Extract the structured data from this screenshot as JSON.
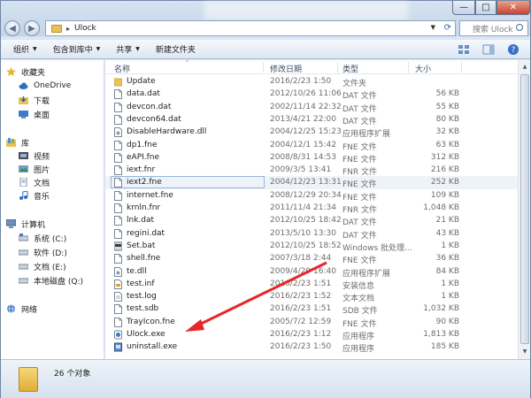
{
  "window": {
    "title": "Ulock",
    "controls": {
      "minimize": "—",
      "maximize": "□",
      "close": "✕"
    }
  },
  "nav": {
    "back": "◀",
    "forward": "▶"
  },
  "address": {
    "path": "Ulock",
    "separator": "▸"
  },
  "search": {
    "placeholder": "搜索 Ulock"
  },
  "toolbar": {
    "organize": "组织",
    "include": "包含到库中",
    "share": "共享",
    "new_folder": "新建文件夹"
  },
  "sidebar": {
    "favorites": "收藏夹",
    "onedrive": "OneDrive",
    "downloads": "下载",
    "desktop": "桌面",
    "libraries": "库",
    "videos": "视频",
    "pictures": "图片",
    "documents": "文档",
    "music": "音乐",
    "computer": "计算机",
    "drive_c": "系统 (C:)",
    "drive_d": "软件 (D:)",
    "drive_e": "文档 (E:)",
    "drive_q": "本地磁盘 (Q:)",
    "network": "网络"
  },
  "columns": {
    "name": "名称",
    "date": "修改日期",
    "type": "类型",
    "size": "大小"
  },
  "files": [
    {
      "name": "Update",
      "date": "2016/2/23 1:50",
      "type": "文件夹",
      "size": "",
      "icon": "folder-icon"
    },
    {
      "name": "data.dat",
      "date": "2012/10/26 11:06",
      "type": "DAT 文件",
      "size": "56 KB",
      "icon": "file-icon"
    },
    {
      "name": "devcon.dat",
      "date": "2002/11/14 22:32",
      "type": "DAT 文件",
      "size": "55 KB",
      "icon": "file-icon"
    },
    {
      "name": "devcon64.dat",
      "date": "2013/4/21 22:00",
      "type": "DAT 文件",
      "size": "80 KB",
      "icon": "file-icon"
    },
    {
      "name": "DisableHardware.dll",
      "date": "2004/12/25 15:23",
      "type": "应用程序扩展",
      "size": "32 KB",
      "icon": "dll-icon"
    },
    {
      "name": "dp1.fne",
      "date": "2004/12/1 15:42",
      "type": "FNE 文件",
      "size": "63 KB",
      "icon": "file-icon"
    },
    {
      "name": "eAPI.fne",
      "date": "2008/8/31 14:53",
      "type": "FNE 文件",
      "size": "312 KB",
      "icon": "file-icon"
    },
    {
      "name": "iext.fnr",
      "date": "2009/3/5 13:41",
      "type": "FNR 文件",
      "size": "216 KB",
      "icon": "file-icon"
    },
    {
      "name": "iext2.fne",
      "date": "2004/12/23 13:31",
      "type": "FNE 文件",
      "size": "252 KB",
      "icon": "file-icon"
    },
    {
      "name": "internet.fne",
      "date": "2008/12/29 20:34",
      "type": "FNE 文件",
      "size": "109 KB",
      "icon": "file-icon"
    },
    {
      "name": "krnln.fnr",
      "date": "2011/11/4 21:34",
      "type": "FNR 文件",
      "size": "1,048 KB",
      "icon": "file-icon"
    },
    {
      "name": "lnk.dat",
      "date": "2012/10/25 18:42",
      "type": "DAT 文件",
      "size": "21 KB",
      "icon": "file-icon"
    },
    {
      "name": "regini.dat",
      "date": "2013/5/10 13:30",
      "type": "DAT 文件",
      "size": "43 KB",
      "icon": "file-icon"
    },
    {
      "name": "Set.bat",
      "date": "2012/10/25 18:52",
      "type": "Windows 批处理...",
      "size": "1 KB",
      "icon": "bat-icon"
    },
    {
      "name": "shell.fne",
      "date": "2007/3/18 2:44",
      "type": "FNE 文件",
      "size": "36 KB",
      "icon": "file-icon"
    },
    {
      "name": "te.dll",
      "date": "2009/4/20 16:40",
      "type": "应用程序扩展",
      "size": "84 KB",
      "icon": "dll-icon"
    },
    {
      "name": "test.inf",
      "date": "2016/2/23 1:51",
      "type": "安装信息",
      "size": "1 KB",
      "icon": "inf-icon"
    },
    {
      "name": "test.log",
      "date": "2016/2/23 1:52",
      "type": "文本文档",
      "size": "1 KB",
      "icon": "txt-icon"
    },
    {
      "name": "test.sdb",
      "date": "2016/2/23 1:51",
      "type": "SDB 文件",
      "size": "1,032 KB",
      "icon": "file-icon"
    },
    {
      "name": "TrayIcon.fne",
      "date": "2005/7/2 12:59",
      "type": "FNE 文件",
      "size": "90 KB",
      "icon": "file-icon"
    },
    {
      "name": "Ulock.exe",
      "date": "2016/2/23 1:12",
      "type": "应用程序",
      "size": "1,813 KB",
      "icon": "ulock-exe-icon"
    },
    {
      "name": "uninstall.exe",
      "date": "2016/2/23 1:50",
      "type": "应用程序",
      "size": "185 KB",
      "icon": "uninstall-exe-icon"
    }
  ],
  "selected_index": 8,
  "status": {
    "count": "26 个对象"
  },
  "colors": {
    "annotation_arrow": "#e8262a",
    "folder": "#e9c15a",
    "selection": "#eef3f9"
  }
}
